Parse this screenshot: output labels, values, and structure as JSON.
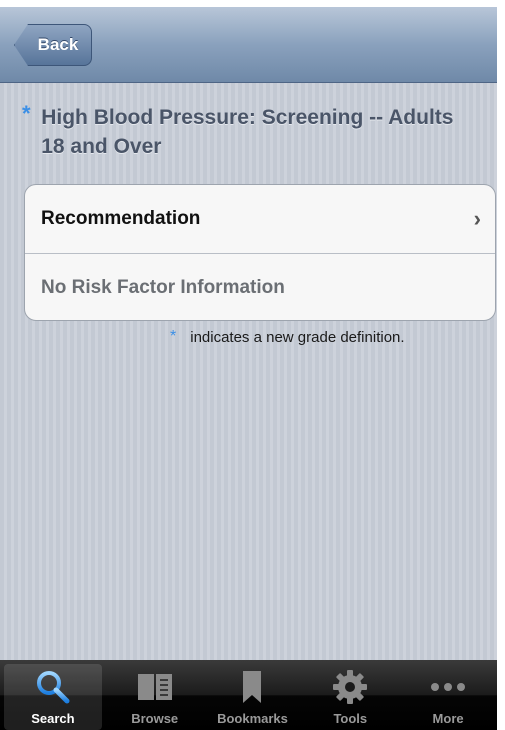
{
  "nav": {
    "back_label": "Back"
  },
  "title": {
    "star": "*",
    "text": "High Blood Pressure: Screening -- Adults 18 and Over"
  },
  "table": {
    "rows": [
      {
        "label": "Recommendation",
        "chevron": "›"
      },
      {
        "label": "No Risk Factor Information"
      }
    ]
  },
  "legend": {
    "star": "*",
    "text": "indicates a new grade definition."
  },
  "tabbar": {
    "tabs": [
      {
        "label": "Search",
        "icon": "search-icon",
        "active": true
      },
      {
        "label": "Browse",
        "icon": "book-icon",
        "active": false
      },
      {
        "label": "Bookmarks",
        "icon": "bookmark-icon",
        "active": false
      },
      {
        "label": "Tools",
        "icon": "gear-icon",
        "active": false
      },
      {
        "label": "More",
        "icon": "more-dots-icon",
        "active": false
      }
    ]
  },
  "colors": {
    "accent": "#3b8fe6",
    "navbar": "#8aa1bd",
    "tabbar": "#000000"
  }
}
